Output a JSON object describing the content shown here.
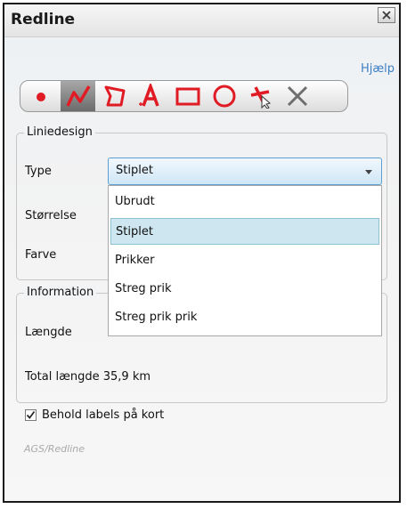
{
  "window": {
    "title": "Redline"
  },
  "help_link": "Hjælp",
  "toolbar": {
    "tools": [
      {
        "icon": "point-icon",
        "selected": false
      },
      {
        "icon": "polyline-icon",
        "selected": true
      },
      {
        "icon": "polygon-icon",
        "selected": false
      },
      {
        "icon": "text-icon",
        "selected": false
      },
      {
        "icon": "rectangle-icon",
        "selected": false
      },
      {
        "icon": "circle-icon",
        "selected": false
      },
      {
        "icon": "move-icon",
        "selected": false
      },
      {
        "icon": "delete-icon",
        "selected": false
      }
    ],
    "color": "#e01b24"
  },
  "liniedesign": {
    "legend": "Liniedesign",
    "type_label": "Type",
    "type_value": "Stiplet",
    "size_label": "Størrelse",
    "color_label": "Farve",
    "options": [
      "Ubrudt",
      "Stiplet",
      "Prikker",
      "Streg prik",
      "Streg prik prik"
    ],
    "selected_option": "Stiplet"
  },
  "information": {
    "legend": "Information",
    "length_label": "Længde",
    "total_length": "Total længde 35,9 km"
  },
  "keep_labels": {
    "label": "Behold labels på kort",
    "checked": true
  },
  "footer": "AGS/Redline"
}
